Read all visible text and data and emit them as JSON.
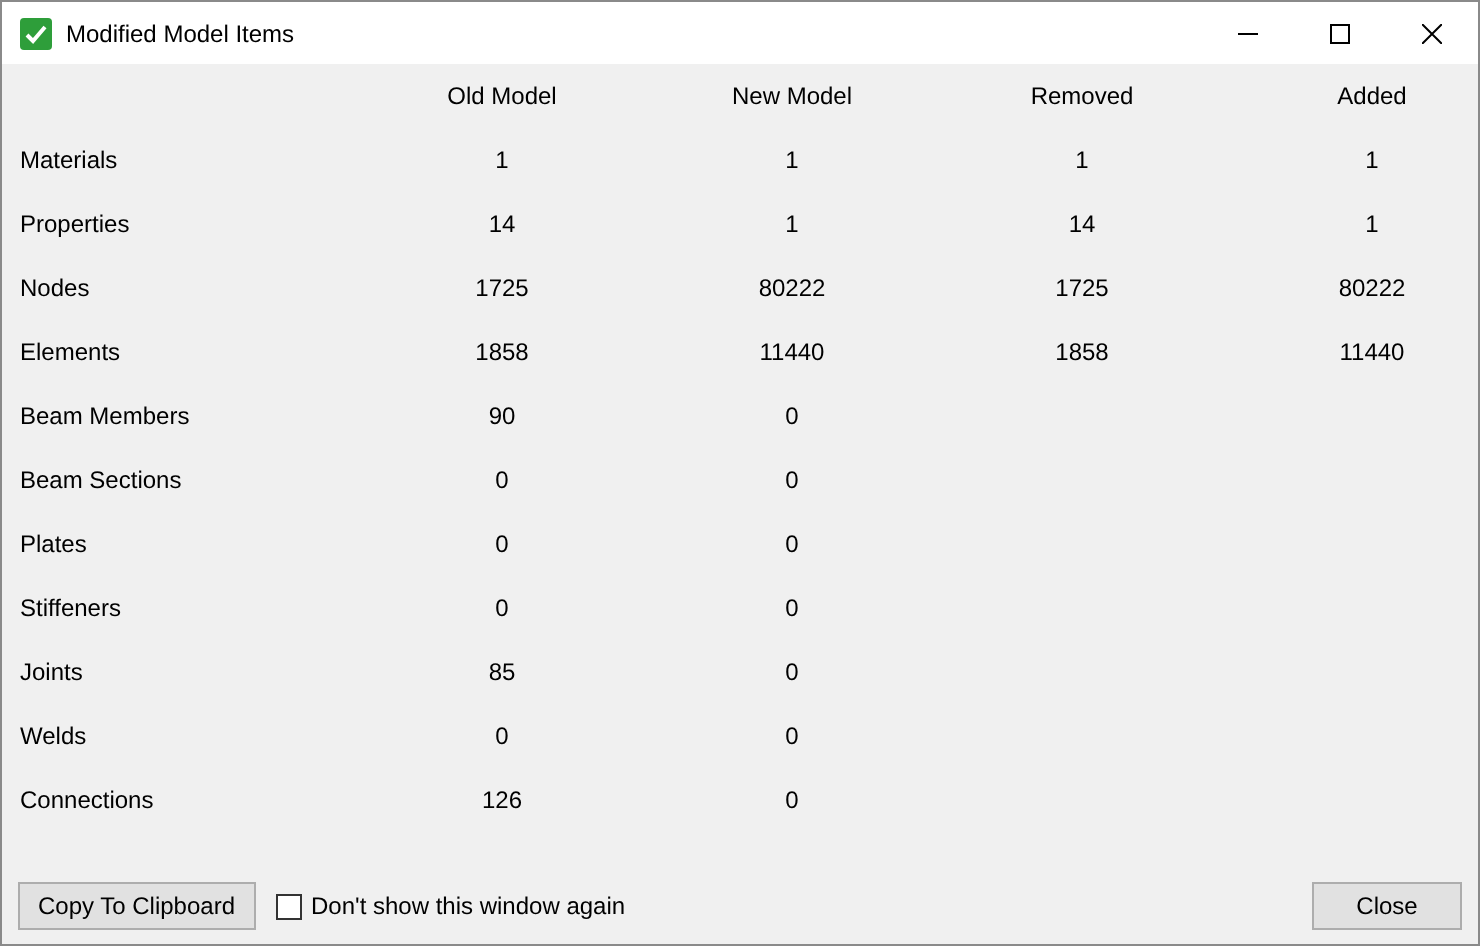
{
  "window": {
    "title": "Modified Model Items"
  },
  "table": {
    "columns": [
      "Old Model",
      "New Model",
      "Removed",
      "Added"
    ],
    "rows": [
      {
        "label": "Materials",
        "values": [
          "1",
          "1",
          "1",
          "1"
        ]
      },
      {
        "label": "Properties",
        "values": [
          "14",
          "1",
          "14",
          "1"
        ]
      },
      {
        "label": "Nodes",
        "values": [
          "1725",
          "80222",
          "1725",
          "80222"
        ]
      },
      {
        "label": "Elements",
        "values": [
          "1858",
          "11440",
          "1858",
          "11440"
        ]
      },
      {
        "label": "Beam Members",
        "values": [
          "90",
          "0"
        ]
      },
      {
        "label": "Beam Sections",
        "values": [
          "0",
          "0"
        ]
      },
      {
        "label": "Plates",
        "values": [
          "0",
          "0"
        ]
      },
      {
        "label": "Stiffeners",
        "values": [
          "0",
          "0"
        ]
      },
      {
        "label": "Joints",
        "values": [
          "85",
          "0"
        ]
      },
      {
        "label": "Welds",
        "values": [
          "0",
          "0"
        ]
      },
      {
        "label": "Connections",
        "values": [
          "126",
          "0"
        ]
      }
    ]
  },
  "footer": {
    "copy_button": "Copy To Clipboard",
    "checkbox": {
      "label": "Don't show this window again",
      "checked": false
    },
    "close_button": "Close"
  }
}
